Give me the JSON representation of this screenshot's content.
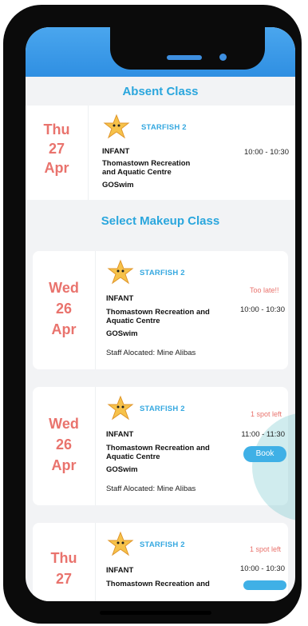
{
  "absent_section": {
    "title": "Absent Class",
    "card": {
      "day": "Thu",
      "date": "27",
      "month": "Apr",
      "level": "STARFISH 2",
      "category": "INFANT",
      "location_line1": "Thomastown Recreation",
      "location_line2": "and Aquatic Centre",
      "provider": "GOSwim",
      "time": "10:00 - 10:30"
    }
  },
  "makeup_section": {
    "title": "Select Makeup Class",
    "cards": [
      {
        "day": "Wed",
        "date": "26",
        "month": "Apr",
        "level": "STARFISH 2",
        "category": "INFANT",
        "location_line1": "Thomastown Recreation and",
        "location_line2": "Aquatic Centre",
        "provider": "GOSwim",
        "staff": "Staff Alocated: Mine Alibas",
        "status": "Too late!!",
        "time": "10:00 - 10:30"
      },
      {
        "day": "Wed",
        "date": "26",
        "month": "Apr",
        "level": "STARFISH 2",
        "category": "INFANT",
        "location_line1": "Thomastown Recreation and",
        "location_line2": "Aquatic Centre",
        "provider": "GOSwim",
        "staff": "Staff Alocated: Mine Alibas",
        "status": "1 spot left",
        "time": "11:00 - 11:30",
        "button": "Book"
      },
      {
        "day": "Thu",
        "date": "27",
        "month": "",
        "level": "STARFISH 2",
        "category": "INFANT",
        "location_line1": "Thomastown Recreation and",
        "status": "1 spot left",
        "time": "10:00 - 10:30"
      }
    ]
  },
  "icons": {
    "class_icon": "starfish-icon"
  },
  "colors": {
    "accent": "#2aa6dd",
    "date": "#e9736d",
    "button": "#3fb0e6",
    "header": "#3a9be8"
  }
}
